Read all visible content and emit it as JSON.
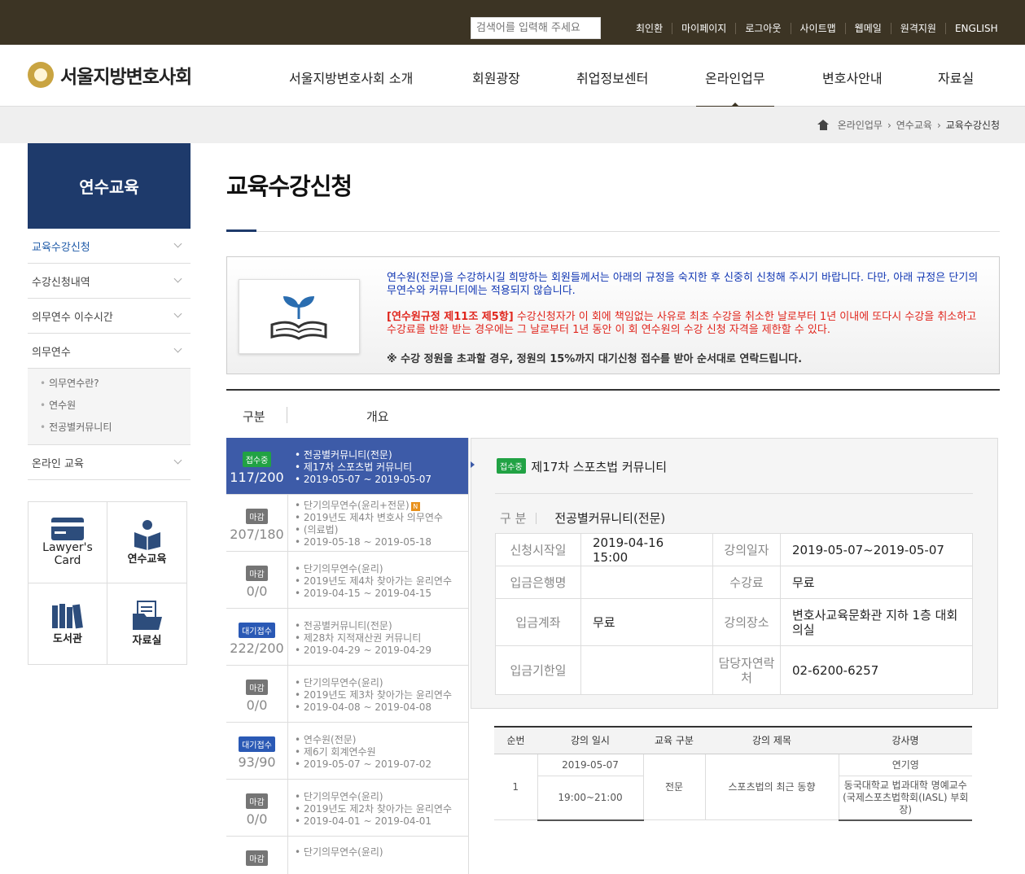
{
  "utility": {
    "search_placeholder": "검색어를 입력해 주세요",
    "links": [
      "최인환",
      "마이페이지",
      "로그아웃",
      "사이트맵",
      "웹메일",
      "원격지원",
      "ENGLISH"
    ]
  },
  "logo": {
    "text": "서울지방변호사회"
  },
  "nav": [
    "서울지방변호사회 소개",
    "회원광장",
    "취업정보센터",
    "온라인업무",
    "변호사안내",
    "자료실"
  ],
  "breadcrumb": [
    "온라인업무",
    "연수교육",
    "교육수강신청"
  ],
  "sidebar": {
    "title": "연수교육",
    "items": [
      "교육수강신청",
      "수강신청내역",
      "의무연수 이수시간",
      "의무연수"
    ],
    "sub_items": [
      "의무연수란?",
      "연수원",
      "전공별커뮤니티"
    ],
    "last_item": "온라인 교육"
  },
  "quick": [
    "Lawyer's Card",
    "연수교육",
    "도서관",
    "자료실"
  ],
  "page_title": "교육수강신청",
  "notice": {
    "p1": "연수원(전문)을 수강하시길 희망하는 회원들께서는 아래의 규정을 숙지한 후 신중히 신청해 주시기 바랍니다. 다만, 아래 규정은 단기의무연수와 커뮤니티에는 적용되지 않습니다.",
    "p2_bold": "[연수원규정 제11조 제5항]",
    "p2": " 수강신청자가 이 회에 책임없는 사유로 최초 수강을 취소한 날로부터 1년 이내에 또다시 수강을 취소하고 수강료를 반환 받는 경우에는 그 날로부터 1년 동안 이 회 연수원의 수강 신청 자격을 제한할 수 있다.",
    "p3": "※ 수강 정원을 초과할 경우, 정원의 15%까지 대기신청 접수를 받아 순서대로 연락드립니다."
  },
  "list_header": {
    "col1": "구분",
    "col2": "개요"
  },
  "list": [
    {
      "status": "접수중",
      "count": "117/200",
      "lines": [
        "전공별커뮤니티(전문)",
        "제17차 스포츠법 커뮤니티",
        "2019-05-07 ~ 2019-05-07"
      ]
    },
    {
      "status": "마감",
      "count": "207/180",
      "lines": [
        "단기의무연수(윤리+전문)",
        "2019년도 제4차 변호사 의무연수",
        "(의료법)",
        "2019-05-18 ~ 2019-05-18"
      ]
    },
    {
      "status": "마감",
      "count": "0/0",
      "lines": [
        "단기의무연수(윤리)",
        "2019년도 제4차 찾아가는 윤리연수",
        "2019-04-15 ~ 2019-04-15"
      ]
    },
    {
      "status": "대기접수",
      "count": "222/200",
      "lines": [
        "전공별커뮤니티(전문)",
        "제28차 지적재산권 커뮤니티",
        "2019-04-29 ~ 2019-04-29"
      ]
    },
    {
      "status": "마감",
      "count": "0/0",
      "lines": [
        "단기의무연수(윤리)",
        "2019년도 제3차 찾아가는 윤리연수",
        "2019-04-08 ~ 2019-04-08"
      ]
    },
    {
      "status": "대기접수",
      "count": "93/90",
      "lines": [
        "연수원(전문)",
        "제6기 회계연수원",
        "2019-05-07 ~ 2019-07-02"
      ]
    },
    {
      "status": "마감",
      "count": "0/0",
      "lines": [
        "단기의무연수(윤리)",
        "2019년도 제2차 찾아가는 윤리연수",
        "2019-04-01 ~ 2019-04-01"
      ]
    },
    {
      "status": "마감",
      "count": "",
      "lines": [
        "단기의무연수(윤리)"
      ]
    }
  ],
  "new_badge": "N",
  "detail": {
    "status": "접수중",
    "title": "제17차 스포츠법 커뮤니티",
    "category_label": "구 분",
    "category": "전공별커뮤니티(전문)",
    "apply_start_label": "신청시작일",
    "apply_start": "2019-04-16 15:00",
    "lecture_date_label": "강의일자",
    "lecture_date": "2019-05-07~2019-05-07",
    "bank_label": "입금은행명",
    "bank": "",
    "fee_label": "수강료",
    "fee": "무료",
    "account_label": "입금계좌",
    "account": "무료",
    "place_label": "강의장소",
    "place": "변호사교육문화관 지하 1층 대회의실",
    "deadline_label": "입금기한일",
    "deadline": "",
    "contact_label": "담당자연락처",
    "contact": "02-6200-6257"
  },
  "course_table": {
    "headers": [
      "순번",
      "강의 일시",
      "교육 구분",
      "강의 제목",
      "강사명"
    ],
    "row": {
      "no": "1",
      "date": "2019-05-07",
      "time": "19:00~21:00",
      "type": "전문",
      "title": "스포츠법의 최근 동향",
      "lecturer": "연기영",
      "lecturer_desc": "동국대학교 법과대학 명예교수 (국제스포츠법학회(IASL) 부회장)"
    }
  }
}
